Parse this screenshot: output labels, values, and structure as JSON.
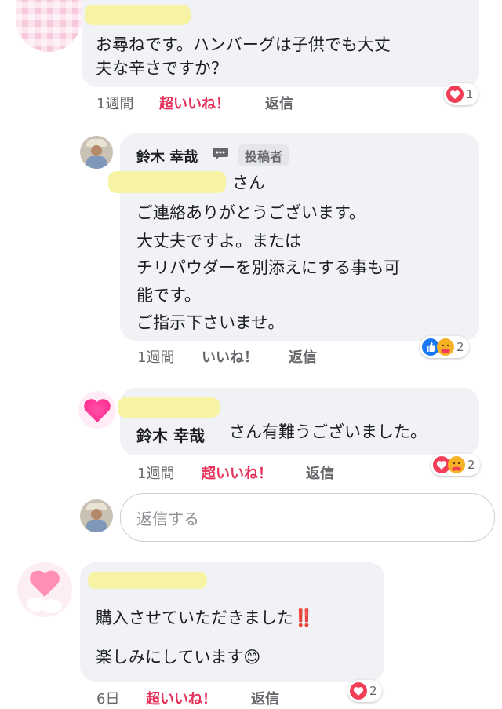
{
  "comment1": {
    "text_line1": "お尋ねです。ハンバーグは子供でも大丈",
    "text_line2": "夫な辛さですか？",
    "time": "1週間",
    "like_label": "超いいね！",
    "reply_label": "返信",
    "reaction_count": "1"
  },
  "reply1": {
    "author": "鈴木 幸哉",
    "author_badge": "投稿者",
    "mention_suffix": "さん",
    "lines": [
      "ご連絡ありがとうございます。",
      "大丈夫ですよ。または",
      "チリパウダーを別添えにする事も可",
      "能です。",
      "ご指示下さいませ。"
    ],
    "time": "1週間",
    "like_label": "いいね！",
    "reply_label": "返信",
    "reaction_count": "2"
  },
  "reply2": {
    "mention_name": "鈴木 幸哉",
    "text": "さん有難うございました。",
    "time": "1週間",
    "like_label": "超いいね！",
    "reply_label": "返信",
    "reaction_count": "2"
  },
  "reply_input": {
    "placeholder": "返信する"
  },
  "comment2": {
    "line1": "購入させていただきました",
    "line1_emoji": "‼️",
    "line2": "楽しみにしています",
    "line2_emoji": "😊",
    "time": "6日",
    "like_label": "超いいね！",
    "reply_label": "返信",
    "reaction_count": "2"
  },
  "colors": {
    "bubble": "#f0f2f5",
    "love": "#f33e58",
    "like": "#1877f2",
    "care": "#f7b125",
    "liked_text": "#e4325a",
    "meta_text": "#65676b"
  }
}
